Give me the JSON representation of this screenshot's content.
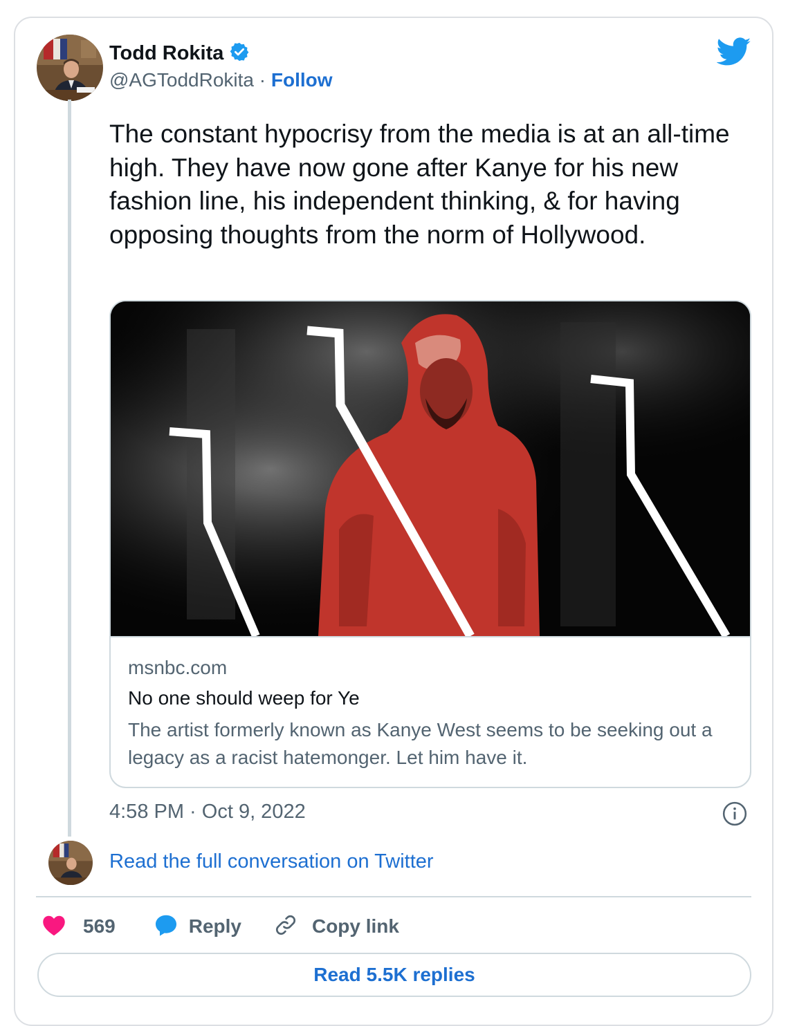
{
  "author": {
    "name": "Todd Rokita",
    "handle": "@AGToddRokita",
    "separator": "·",
    "follow_label": "Follow",
    "verified_icon": "verified-badge-icon"
  },
  "tweet": {
    "text": "The constant hypocrisy from the media is at an all-time high. They have now gone after Kanye for his new fashion line, his independent thinking, & for having opposing thoughts from the norm of Hollywood.",
    "timestamp": "4:58 PM · Oct 9, 2022"
  },
  "link_card": {
    "domain": "msnbc.com",
    "title": "No one should weep for Ye",
    "description": "The artist formerly known as Kanye West seems to be seeking out a legacy as a racist hatemonger. Let him have it."
  },
  "conversation_link": "Read the full conversation on Twitter",
  "actions": {
    "likes": "569",
    "reply_label": "Reply",
    "copy_link_label": "Copy link"
  },
  "read_replies_label": "Read 5.5K replies",
  "colors": {
    "link_blue": "#1d6fd1",
    "twitter_blue": "#1d9bf0",
    "heart_pink": "#f91880",
    "secondary_text": "#536471"
  }
}
